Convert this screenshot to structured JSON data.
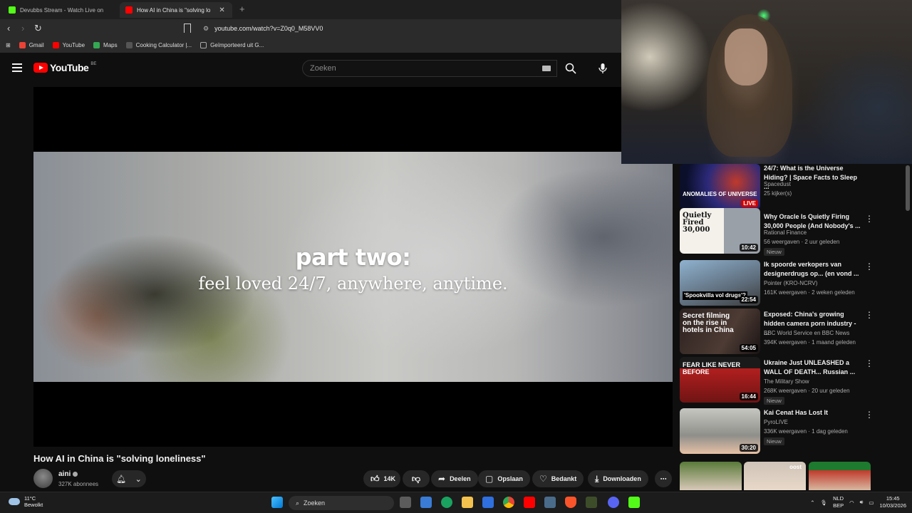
{
  "browser": {
    "tabs": [
      {
        "label": "Devubbs Stream - Watch Live on",
        "active": false,
        "favicon_color": "#53fc18"
      },
      {
        "label": "How AI in China is \"solving lo",
        "active": true,
        "favicon_color": "#ff0000"
      }
    ],
    "new_tab_icon": "+",
    "url": "youtube.com/watch?v=Z0q0_M58VV0",
    "bookmarks": [
      {
        "label": "Gmail",
        "color": "#ea4335"
      },
      {
        "label": "YouTube",
        "color": "#ff0000"
      },
      {
        "label": "Maps",
        "color": "#34a853"
      },
      {
        "label": "Cooking Calculator |...",
        "color": "#555555"
      },
      {
        "label": "Geïmporteerd uit G...",
        "color": "#aaaaaa"
      }
    ]
  },
  "youtube": {
    "logo_text": "YouTube",
    "country_code": "BE",
    "search_placeholder": "Zoeken"
  },
  "video": {
    "overlay_line1": "part two:",
    "overlay_line2": "feel loved 24/7, anywhere, anytime.",
    "title": "How AI in China is \"solving loneliness\"",
    "channel": "aini",
    "subscribers": "327K abonnees",
    "actions": {
      "likes": "14K",
      "share": "Deelen",
      "save": "Opslaan",
      "thanks": "Bedankt",
      "download": "Downloaden"
    }
  },
  "recommendations": [
    {
      "title": "24/7: What is the Universe Hiding? | Space Facts to Sleep ...",
      "channel": "Spacedust",
      "meta": "25 kijker(s)",
      "badge": "",
      "duration": "LIVE",
      "thumb_text": "ANOMALIES OF UNIVERSE",
      "thumb_color": "#0b0f2a"
    },
    {
      "title": "Why Oracle Is Quietly Firing 30,000 People (And Nobody's ...",
      "channel": "Rational Finance",
      "meta": "56 weergaven · 2 uur geleden",
      "badge": "Nieuw",
      "duration": "10:42",
      "thumb_text": "Quietly Fired 30,000",
      "thumb_color": "#e8e6e0"
    },
    {
      "title": "Ik spoorde verkopers van designerdrugs op... (en vond ...",
      "channel": "Pointer (KRO-NCRV)",
      "meta": "161K weergaven · 2 weken geleden",
      "badge": "",
      "duration": "22:54",
      "thumb_text": "'Spookvilla vol drugs'?",
      "thumb_color": "#6b7f93"
    },
    {
      "title": "Exposed: China's growing hidden camera porn industry - ...",
      "channel": "BBC World Service en BBC News",
      "meta": "394K weergaven · 1 maand geleden",
      "badge": "",
      "duration": "54:05",
      "thumb_text": "Secret filming on the rise in hotels in China",
      "thumb_color": "#2d2220"
    },
    {
      "title": "Ukraine Just UNLEASHED a WALL OF DEATH... Russian ...",
      "channel": "The Military Show",
      "meta": "268K weergaven · 20 uur geleden",
      "badge": "Nieuw",
      "duration": "16:44",
      "thumb_text": "FEAR LIKE NEVER BEFORE",
      "thumb_color": "#8a1a1a"
    },
    {
      "title": "Kai Cenat Has Lost It",
      "channel": "PyroLIVE",
      "meta": "336K weergaven · 1 dag geleden",
      "badge": "Nieuw",
      "duration": "30:20",
      "thumb_text": "",
      "thumb_color": "#9a9a96"
    }
  ],
  "shorts_label": "oost",
  "taskbar": {
    "temperature": "11°C",
    "weather": "Bewolkt",
    "search": "Zoeken",
    "lang1": "NLD",
    "lang2": "BEP",
    "time": "15:45",
    "date": "10/03/2026"
  }
}
